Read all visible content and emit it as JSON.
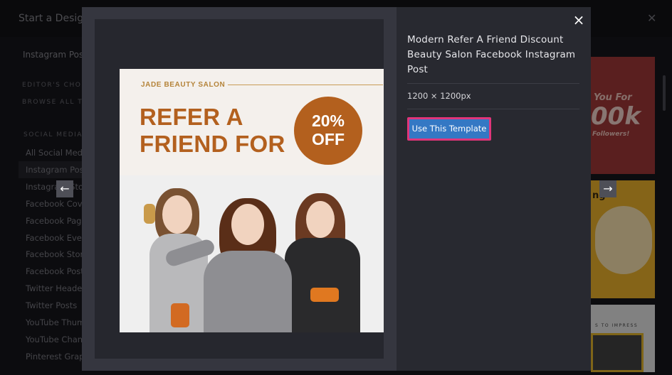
{
  "background": {
    "title": "Start a Design",
    "search_value": "Instagram Post",
    "editors_choice": "EDITOR'S CHOICE",
    "browse_all": "BROWSE ALL TEMPLATES",
    "section_label": "SOCIAL MEDIA",
    "sidebar_items": [
      {
        "label": "All Social Media",
        "active": false
      },
      {
        "label": "Instagram Posts",
        "active": true
      },
      {
        "label": "Instagram Stories",
        "active": false
      },
      {
        "label": "Facebook Covers",
        "active": false
      },
      {
        "label": "Facebook Page Covers",
        "active": false
      },
      {
        "label": "Facebook Event Covers",
        "active": false
      },
      {
        "label": "Facebook Stories",
        "active": false
      },
      {
        "label": "Facebook Posts",
        "active": false
      },
      {
        "label": "Twitter Headers",
        "active": false
      },
      {
        "label": "Twitter Posts",
        "active": false
      },
      {
        "label": "YouTube Thumbnails",
        "active": false
      },
      {
        "label": "YouTube Channel Art",
        "active": false
      },
      {
        "label": "Pinterest Graphics",
        "active": false
      }
    ],
    "thumb1_line1": "You For",
    "thumb1_line2": "00k",
    "thumb1_line3": "Followers!",
    "thumb2_text": "ng",
    "thumb3_text": "S TO IMPRESS"
  },
  "modal": {
    "title": "Modern Refer A Friend Discount Beauty Salon Facebook Instagram Post",
    "size": "1200 × 1200px",
    "use_button": "Use This Template",
    "close_icon": "×",
    "prev_icon": "←",
    "next_icon": "→"
  },
  "design": {
    "salon_name": "JADE BEAUTY SALON",
    "headline_line1": "REFER A",
    "headline_line2": "FRIEND FOR",
    "discount_line1": "20%",
    "discount_line2": "OFF",
    "accent_color": "#b3601e",
    "gold_color": "#b5843a"
  },
  "colors": {
    "button_bg": "#3478c4",
    "button_border": "#e0357a",
    "modal_bg": "#282930"
  }
}
